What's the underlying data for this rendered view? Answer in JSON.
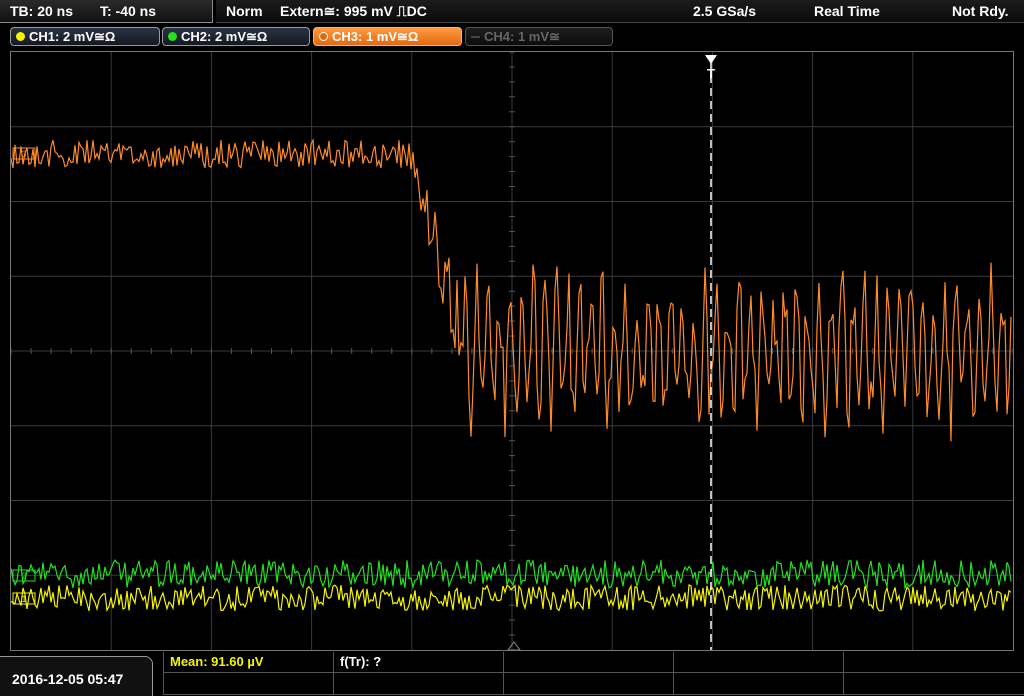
{
  "topbar": {
    "timebase": "TB: 20 ns",
    "trigger_offset": "T: -40 ns",
    "trigger_mode": "Norm",
    "trigger_source": "Extern≅: 995 mV ⎍DC",
    "sample_rate": "2.5 GSa/s",
    "acq_mode": "Real Time",
    "status": "Not Rdy."
  },
  "channels": [
    {
      "label": "CH1: 2 mV≅Ω",
      "color": "#f5f500",
      "active": true
    },
    {
      "label": "CH2: 2 mV≅Ω",
      "color": "#22e022",
      "active": true
    },
    {
      "label": "CH3: 1 mV≅Ω",
      "color": "#ff8a2a",
      "active": true,
      "selected": true
    },
    {
      "label": "CH4: 1 mV≅",
      "color": "#666666",
      "active": false
    }
  ],
  "screen": {
    "trigger_marker": "T",
    "ch3_tag": "3",
    "ch2_tag": "2",
    "ch1_tag": "1"
  },
  "bottom": {
    "datetime": "2016-12-05 05:47",
    "mean_label": "Mean: 91.60 µV",
    "rise_label": "f(Tr): ?"
  },
  "colors": {
    "ch1": "#f5f500",
    "ch2": "#22e022",
    "ch3": "#ff8a2a",
    "grid": "#3a3a3a",
    "trigger_line": "#ffffff"
  }
}
